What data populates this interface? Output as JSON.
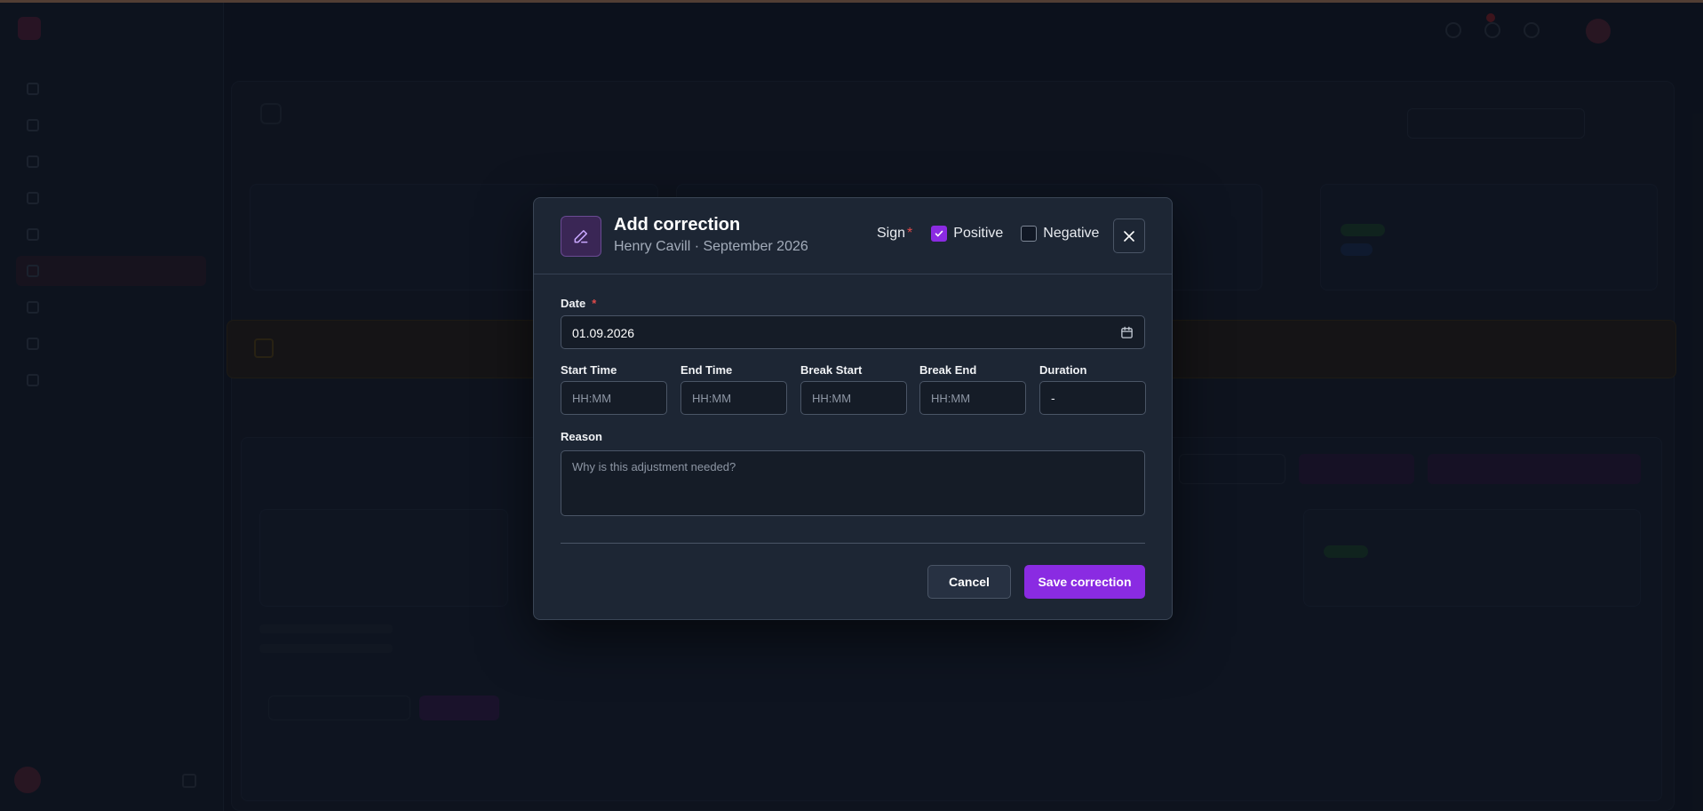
{
  "modal": {
    "title": "Add correction",
    "subtitle": "Henry Cavill · September 2026",
    "sign": {
      "label": "Sign",
      "required_mark": "*",
      "positive_label": "Positive",
      "negative_label": "Negative",
      "positive_checked": true,
      "negative_checked": false
    },
    "date": {
      "label": "Date",
      "required_mark": "*",
      "value": "01.09.2026"
    },
    "times": {
      "start_label": "Start Time",
      "start_placeholder": "HH:MM",
      "end_label": "End Time",
      "end_placeholder": "HH:MM",
      "break_start_label": "Break Start",
      "break_start_placeholder": "HH:MM",
      "break_end_label": "Break End",
      "break_end_placeholder": "HH:MM",
      "duration_label": "Duration",
      "duration_value": "-"
    },
    "reason": {
      "label": "Reason",
      "placeholder": "Why is this adjustment needed?"
    },
    "buttons": {
      "cancel": "Cancel",
      "save": "Save correction"
    }
  },
  "colors": {
    "accent": "#8a2be2",
    "required": "#e04a4a",
    "modal_bg": "#1d2634",
    "input_bg": "#151c27",
    "page_bg": "#0f1522"
  },
  "icons": {
    "header": "pencil-icon",
    "close": "close-icon",
    "date": "calendar-icon",
    "checkbox": "check-icon"
  }
}
